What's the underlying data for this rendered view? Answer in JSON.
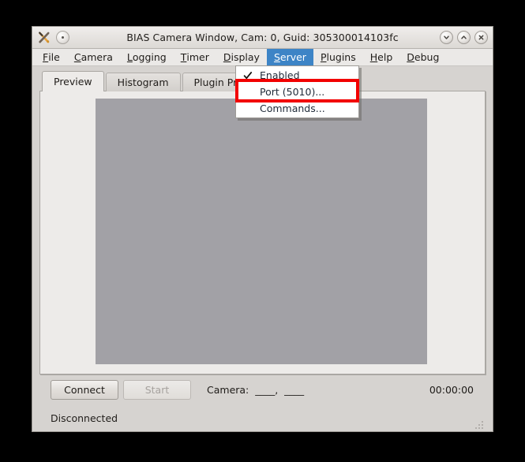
{
  "window": {
    "title": "BIAS Camera Window, Cam: 0, Guid: 305300014103fc",
    "app_icon_name": "bias-app-icon",
    "controls": {
      "menu_dot": "window-menu-button",
      "minimize": "minimize-button",
      "maximize": "maximize-button",
      "close": "close-button"
    }
  },
  "menubar": {
    "items": [
      {
        "label": "File",
        "mnemonic": "F",
        "rest": "ile",
        "active": false
      },
      {
        "label": "Camera",
        "mnemonic": "C",
        "rest": "amera",
        "active": false
      },
      {
        "label": "Logging",
        "mnemonic": "L",
        "rest": "ogging",
        "active": false
      },
      {
        "label": "Timer",
        "mnemonic": "T",
        "rest": "imer",
        "active": false
      },
      {
        "label": "Display",
        "mnemonic": "D",
        "rest": "isplay",
        "active": false
      },
      {
        "label": "Server",
        "mnemonic": "S",
        "rest": "erver",
        "active": true
      },
      {
        "label": "Plugins",
        "mnemonic": "P",
        "rest": "lugins",
        "active": false
      },
      {
        "label": "Help",
        "mnemonic": "H",
        "rest": "elp",
        "active": false
      },
      {
        "label": "Debug",
        "mnemonic": "D",
        "rest": "ebug",
        "active": false
      }
    ],
    "active_highlight_color": "#3d84c6"
  },
  "server_menu": {
    "items": [
      {
        "label": "Enabled",
        "checked": true,
        "highlighted": false
      },
      {
        "label": "Port (5010)...",
        "checked": false,
        "highlighted": true
      },
      {
        "label": "Commands...",
        "checked": false,
        "highlighted": false
      }
    ]
  },
  "annotation": {
    "color": "#f20000",
    "target": "Port (5010)..."
  },
  "tabs": [
    {
      "label": "Preview",
      "selected": true
    },
    {
      "label": "Histogram",
      "selected": false
    },
    {
      "label": "Plugin Preview",
      "selected": false
    }
  ],
  "preview": {
    "image_placeholder_color": "#a2a1a6",
    "panel_background": "#edebe9"
  },
  "bottom": {
    "connect_label": "Connect",
    "start_label": "Start",
    "start_disabled": true,
    "camera_label": "Camera:  ____,  ____",
    "timer": "00:00:00"
  },
  "statusbar": {
    "text": "Disconnected"
  }
}
